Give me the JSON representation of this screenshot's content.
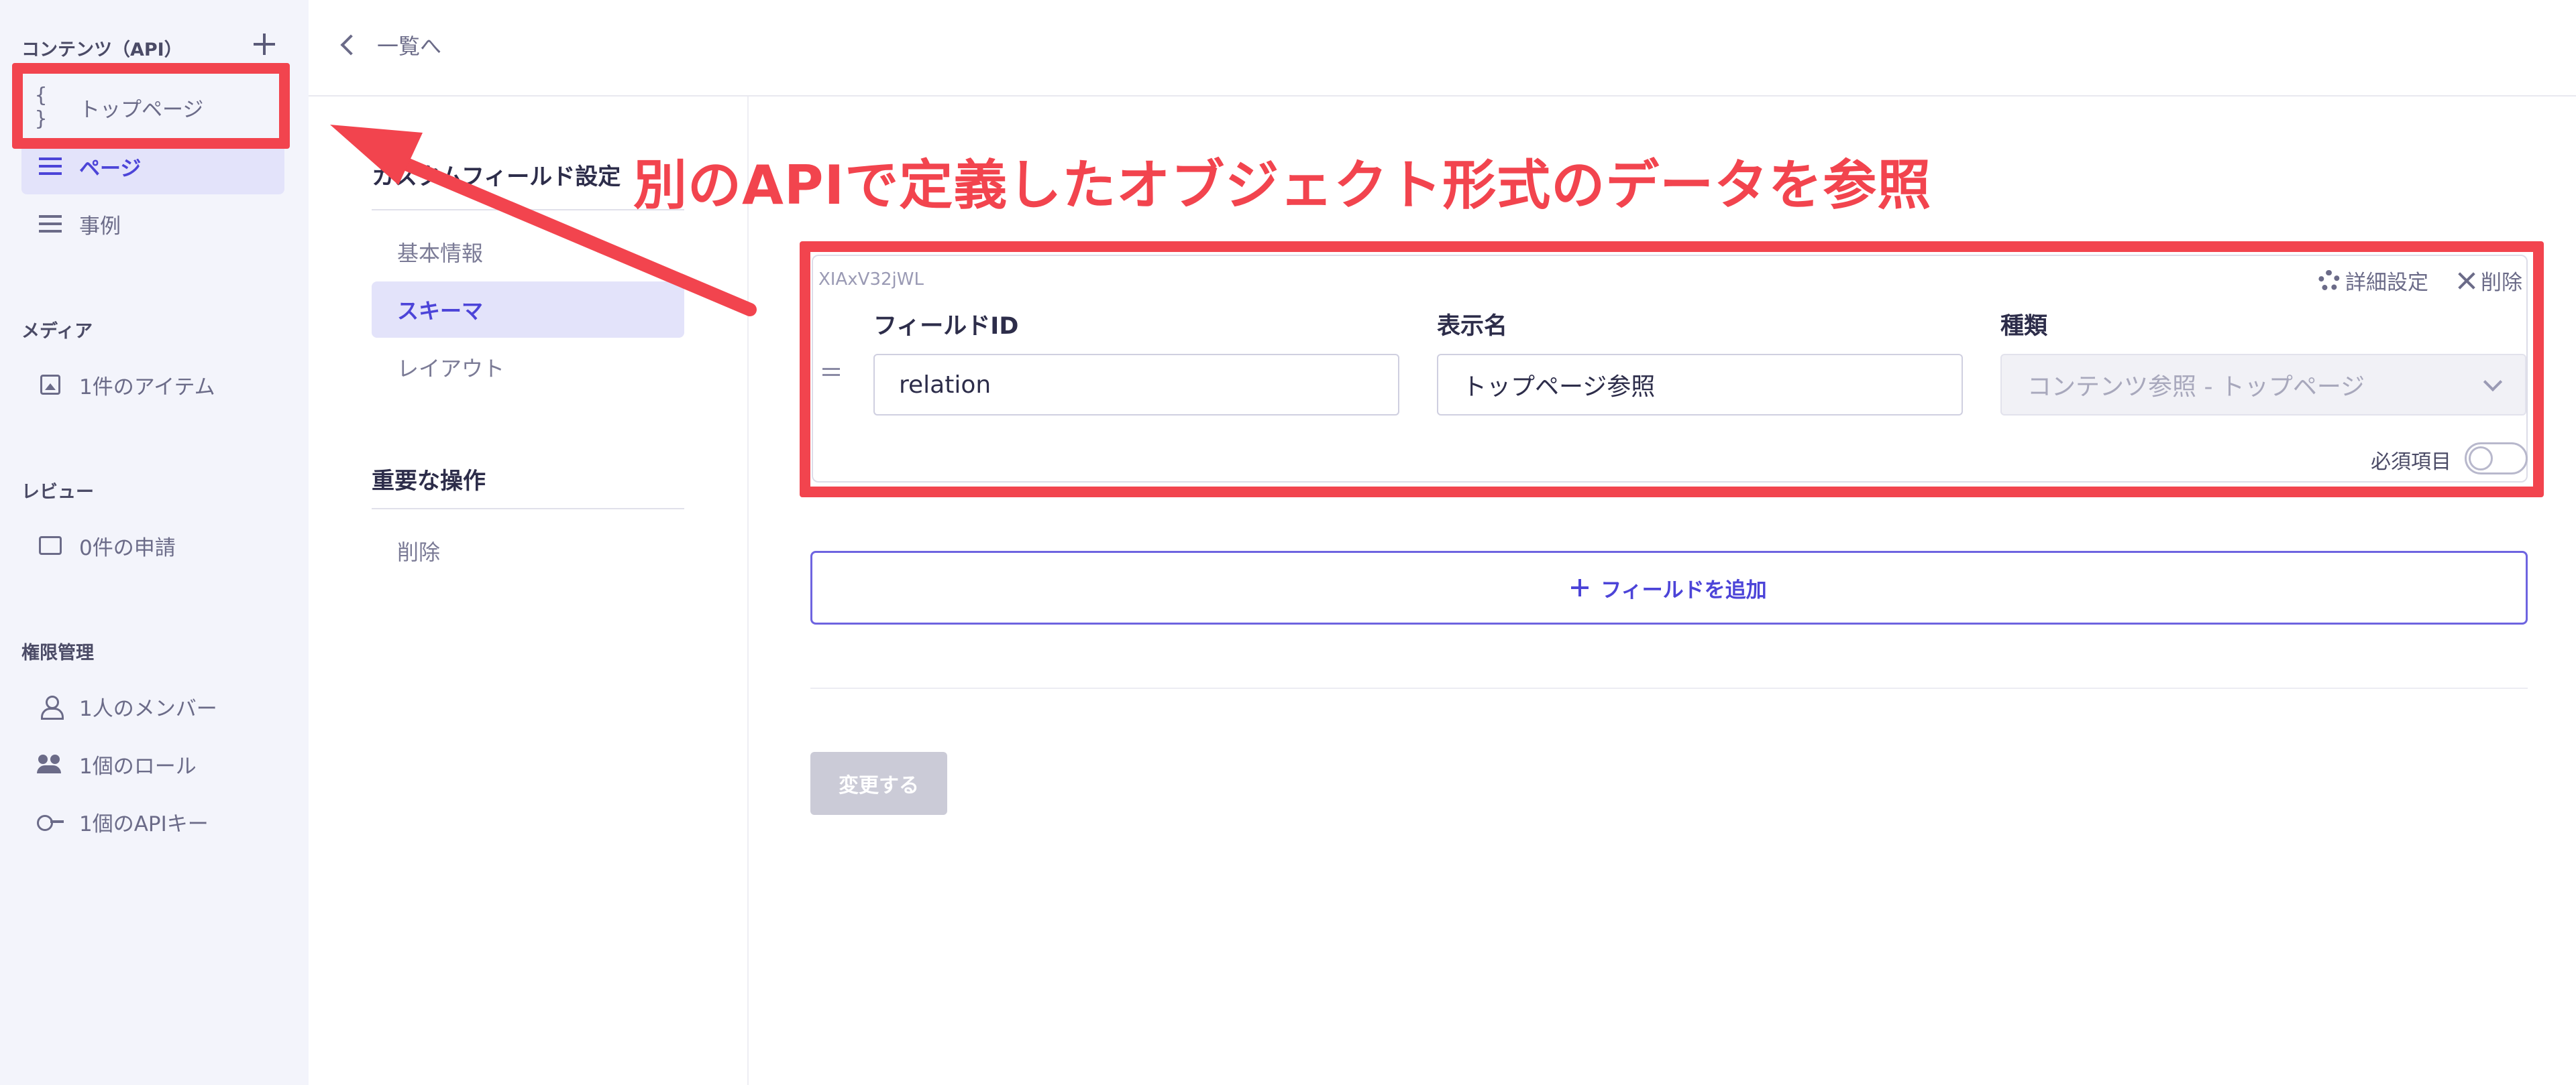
{
  "sidebar": {
    "contents_header": "コンテンツ（API）",
    "content_items": [
      {
        "label": "トップページ",
        "icon": "braces-icon"
      },
      {
        "label": "ページ",
        "icon": "list-icon"
      },
      {
        "label": "事例",
        "icon": "list-icon"
      }
    ],
    "media_header": "メディア",
    "media_item": "1件のアイテム",
    "review_header": "レビュー",
    "review_item": "0件の申請",
    "permission_header": "権限管理",
    "permission_items": [
      {
        "label": "1人のメンバー",
        "icon": "person-icon"
      },
      {
        "label": "1個のロール",
        "icon": "people-icon"
      },
      {
        "label": "1個のAPIキー",
        "icon": "key-icon"
      }
    ]
  },
  "topbar": {
    "back_label": "一覧へ"
  },
  "settings_nav": {
    "header": "カスタムフィールド設定",
    "items": [
      "基本情報",
      "スキーマ",
      "レイアウト"
    ],
    "danger_header": "重要な操作",
    "danger_item": "削除"
  },
  "field": {
    "id": "XIAxV32jWL",
    "settings_label": "詳細設定",
    "delete_label": "削除",
    "field_id_label": "フィールドID",
    "field_id_value": "relation",
    "display_name_label": "表示名",
    "display_name_value": "トップページ参照",
    "type_label": "種類",
    "type_value": "コンテンツ参照 - トップページ",
    "required_label": "必須項目",
    "required": false
  },
  "add_field_label": "フィールドを追加",
  "save_label": "変更する",
  "annotation": {
    "text": "別のAPIで定義したオブジェクト形式のデータを参照",
    "color": "#f2444e"
  },
  "colors": {
    "accent": "#4c44d8",
    "sidebar_bg": "#f3f4fb",
    "active_bg": "#e3e3fa"
  }
}
